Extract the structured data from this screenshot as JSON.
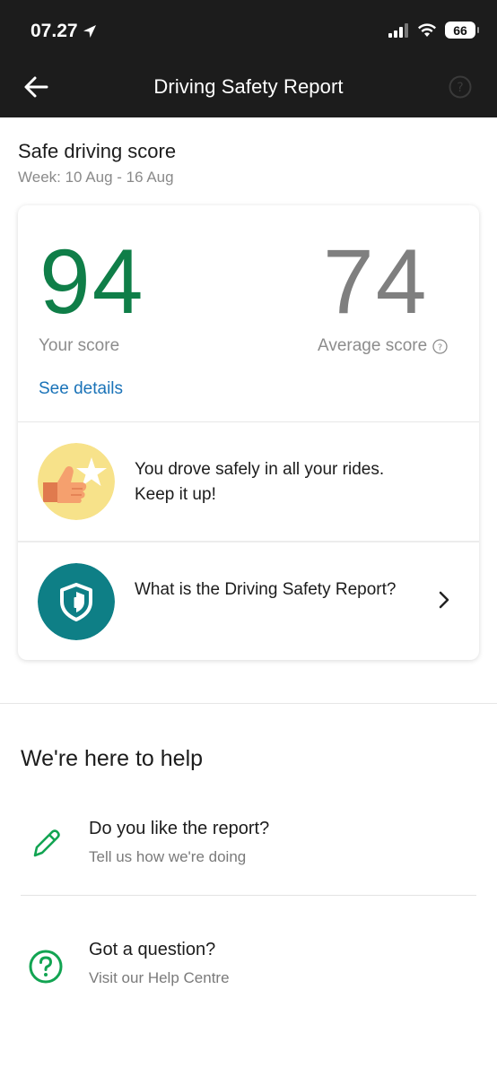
{
  "status_bar": {
    "time": "07.27",
    "battery": "66"
  },
  "nav": {
    "title": "Driving Safety Report"
  },
  "header": {
    "title": "Safe driving score",
    "week": "Week: 10 Aug - 16 Aug"
  },
  "scores": {
    "your_score": "94",
    "your_label": "Your score",
    "average_score": "74",
    "average_label": "Average score",
    "see_details": "See details"
  },
  "messages": {
    "safe_message": "You drove safely in all your rides. Keep it up!",
    "info_link": "What is the Driving Safety Report?"
  },
  "help": {
    "title": "We're here to help",
    "items": [
      {
        "title": "Do you like the report?",
        "subtitle": "Tell us how we're doing"
      },
      {
        "title": "Got a question?",
        "subtitle": "Visit our Help Centre"
      }
    ]
  },
  "colors": {
    "header_bg": "#1c1c1c",
    "your_score": "#0f7e48",
    "average_score": "#7f7f7f",
    "link": "#1a73b8",
    "teal": "#0e7f86",
    "help_green": "#12a452",
    "badge_yellow": "#f7e28a"
  },
  "icons": {
    "back": "arrow-left-icon",
    "nav_help": "question-circle-icon",
    "info": "info-circle-icon",
    "safe": "thumbs-up-star-icon",
    "shield": "shield-icon",
    "chevron": "chevron-right-icon",
    "pencil": "pencil-icon",
    "question": "question-circle-icon"
  }
}
